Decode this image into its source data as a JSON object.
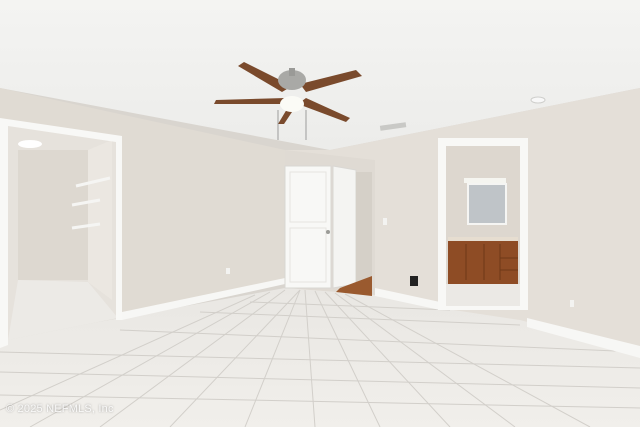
{
  "photo": {
    "watermark": "© 2025 NEFMLS, Inc",
    "colors": {
      "ceiling": "#f1f1ef",
      "wall": "#e2ddd6",
      "wall_shadow": "#d6d1ca",
      "baseboard": "#f7f7f5",
      "floor_tile": "#eeece8",
      "grout": "#cfccc7",
      "door": "#f8f8f6",
      "fan_blade": "#7a4a2c",
      "fan_metal": "#a9a9a6",
      "vanity": "#8e4c25",
      "hardwood": "#9a5a2f"
    }
  }
}
